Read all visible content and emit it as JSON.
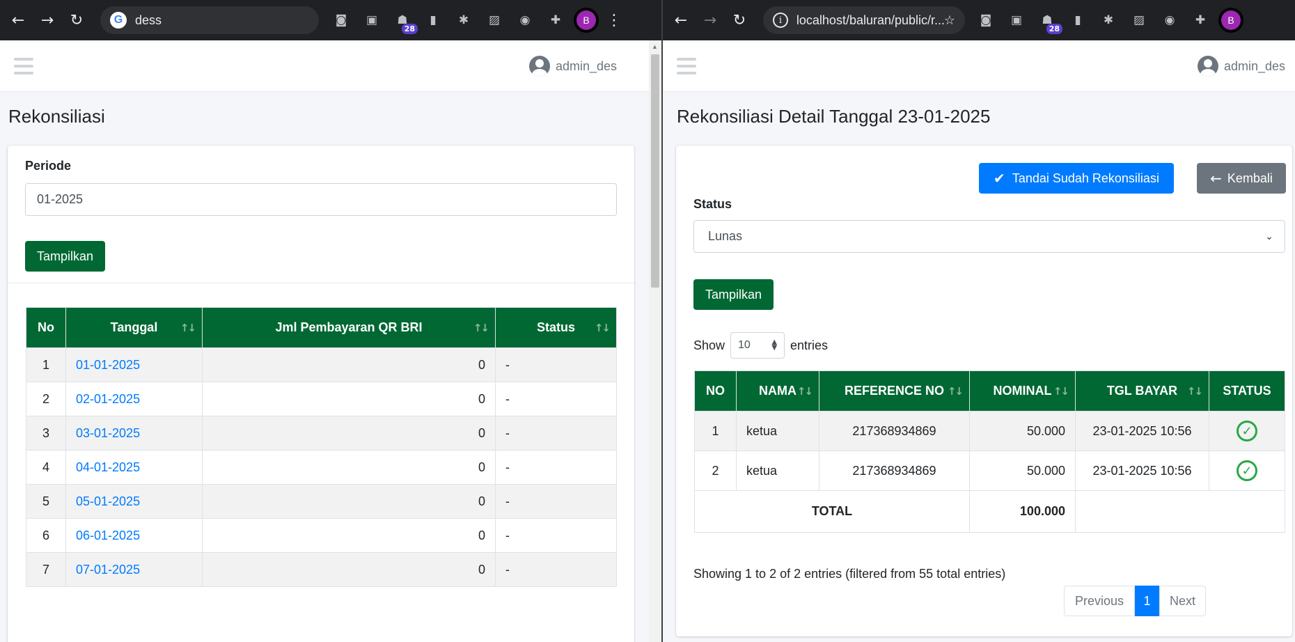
{
  "left": {
    "address": "dess",
    "extension_badge": "28",
    "profile_initial": "B",
    "user": "admin_des",
    "page_title": "Rekonsiliasi",
    "period_label": "Periode",
    "period_value": "01-2025",
    "show_button": "Tampilkan",
    "table": {
      "headers": [
        "No",
        "Tanggal",
        "Jml Pembayaran QR BRI",
        "Status"
      ],
      "rows": [
        {
          "no": "1",
          "date": "01-01-2025",
          "amount": "0",
          "status": "-"
        },
        {
          "no": "2",
          "date": "02-01-2025",
          "amount": "0",
          "status": "-"
        },
        {
          "no": "3",
          "date": "03-01-2025",
          "amount": "0",
          "status": "-"
        },
        {
          "no": "4",
          "date": "04-01-2025",
          "amount": "0",
          "status": "-"
        },
        {
          "no": "5",
          "date": "05-01-2025",
          "amount": "0",
          "status": "-"
        },
        {
          "no": "6",
          "date": "06-01-2025",
          "amount": "0",
          "status": "-"
        },
        {
          "no": "7",
          "date": "07-01-2025",
          "amount": "0",
          "status": "-"
        }
      ]
    }
  },
  "right": {
    "address": "localhost/baluran/public/r...",
    "extension_badge": "28",
    "profile_initial": "B",
    "user": "admin_des",
    "page_title": "Rekonsiliasi Detail Tanggal 23-01-2025",
    "mark_button": "Tandai Sudah Rekonsiliasi",
    "back_button": "Kembali",
    "status_label": "Status",
    "status_value": "Lunas",
    "show_button": "Tampilkan",
    "show_prefix": "Show",
    "entries_value": "10",
    "show_suffix": "entries",
    "table": {
      "headers": [
        "NO",
        "NAMA",
        "REFERENCE NO",
        "NOMINAL",
        "TGL BAYAR",
        "STATUS"
      ],
      "rows": [
        {
          "no": "1",
          "name": "ketua",
          "ref": "217368934869",
          "nominal": "50.000",
          "date": "23-01-2025 10:56"
        },
        {
          "no": "2",
          "name": "ketua",
          "ref": "217368934869",
          "nominal": "50.000",
          "date": "23-01-2025 10:56"
        }
      ],
      "total_label": "TOTAL",
      "total_value": "100.000"
    },
    "info": "Showing 1 to 2 of 2 entries (filtered from 55 total entries)",
    "pager": {
      "previous": "Previous",
      "current": "1",
      "next": "Next"
    }
  },
  "colors": {
    "primary_green": "#016833",
    "primary_blue": "#007bff",
    "success": "#28a745"
  }
}
